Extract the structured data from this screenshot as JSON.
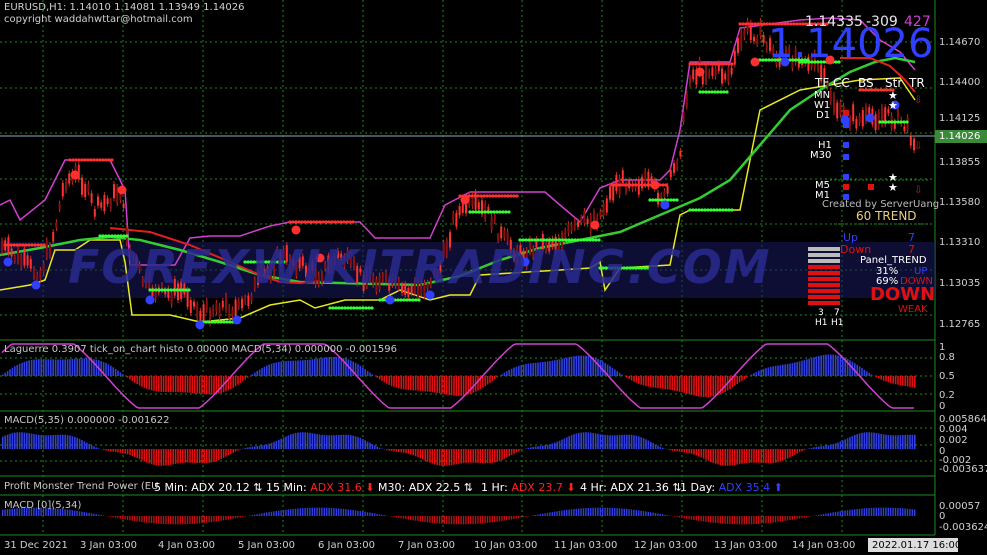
{
  "header": {
    "symbol_line": "EURUSD,H1: 1.14010 1.14081 1.13949 1.14026",
    "copyright": "copyright waddahwttar@hotmail.com"
  },
  "main_chart": {
    "big_price": "1.14026",
    "top_numbers": [
      "1.14335",
      "-309",
      "427"
    ],
    "current_price_tag": "1.14026",
    "price_axis": [
      "1.14670",
      "1.14400",
      "1.14125",
      "1.13855",
      "1.13580",
      "1.13310",
      "1.13035",
      "1.12765"
    ],
    "watermark": "FOREXWIKITRADING.COM"
  },
  "dashboard": {
    "headers": [
      "TF",
      "CC",
      "BS",
      "Str",
      "TR"
    ],
    "timeframes": [
      "MN",
      "W1",
      "D1",
      "H1",
      "M30",
      "M5",
      "M1"
    ],
    "created_by": "Created by ServerUang",
    "trend_label": "60 TREND",
    "up_label": "Up",
    "down_label": "Down",
    "panel_trend": "Panel_TREND",
    "pct_up": "31%",
    "pct_down": "69%",
    "up_word": "UP",
    "down_word": "DOWN",
    "big_down": "DOWN",
    "weak": "WEAK",
    "h_labels": [
      "3",
      "7",
      "H1",
      "H1"
    ],
    "side_numbers": [
      "7",
      "7"
    ]
  },
  "panels": {
    "laguerre_title": "Laguerre 0.3907 tick_on_chart histo 0.00000  MACD(5,34) 0.000000 -0.001596",
    "laguerre_axis": [
      "1",
      "0.8",
      "0.5",
      "0.2",
      "0"
    ],
    "macd1_title": "MACD(5,35) 0.000000 -0.001622",
    "macd1_axis": [
      "0.005864",
      "0.004",
      "0.002",
      "0",
      "-0.002",
      "-0.003637"
    ],
    "power_title": "Profit Monster Trend Power (EU",
    "adx": [
      {
        "label": "5 Min:",
        "value": "ADX 20.12",
        "color": "#ffffff"
      },
      {
        "label": "15 Min:",
        "value": "ADX 31.6",
        "color": "#ff2020"
      },
      {
        "label": "M30:",
        "value": "ADX 22.5",
        "color": "#ffffff"
      },
      {
        "label": "1 Hr:",
        "value": "ADX 23.7",
        "color": "#ff2020"
      },
      {
        "label": "4 Hr:",
        "value": "ADX 21.36",
        "color": "#ffffff"
      },
      {
        "label": "1 Day:",
        "value": "ADX 35.4",
        "color": "#3040ff"
      }
    ],
    "macd2_title": "MACD [0](5,34)",
    "macd2_axis": [
      "0.00057",
      "0",
      "-0.003624"
    ]
  },
  "time_axis": [
    "31 Dec 2021",
    "3 Jan 03:00",
    "4 Jan 03:00",
    "5 Jan 03:00",
    "6 Jan 03:00",
    "7 Jan 03:00",
    "10 Jan 03:00",
    "11 Jan 03:00",
    "12 Jan 03:00",
    "13 Jan 03:00",
    "14 Jan 03:00"
  ],
  "time_cursor": "2022.01.17 16:00",
  "colors": {
    "grid": "#1e8a1e",
    "sma_green": "#33cc33",
    "envelope_magenta": "#d040d0",
    "envelope_yellow": "#e8e820",
    "ma_red": "#e02020",
    "hist_blue": "#3040e0",
    "hist_red": "#e01010"
  }
}
